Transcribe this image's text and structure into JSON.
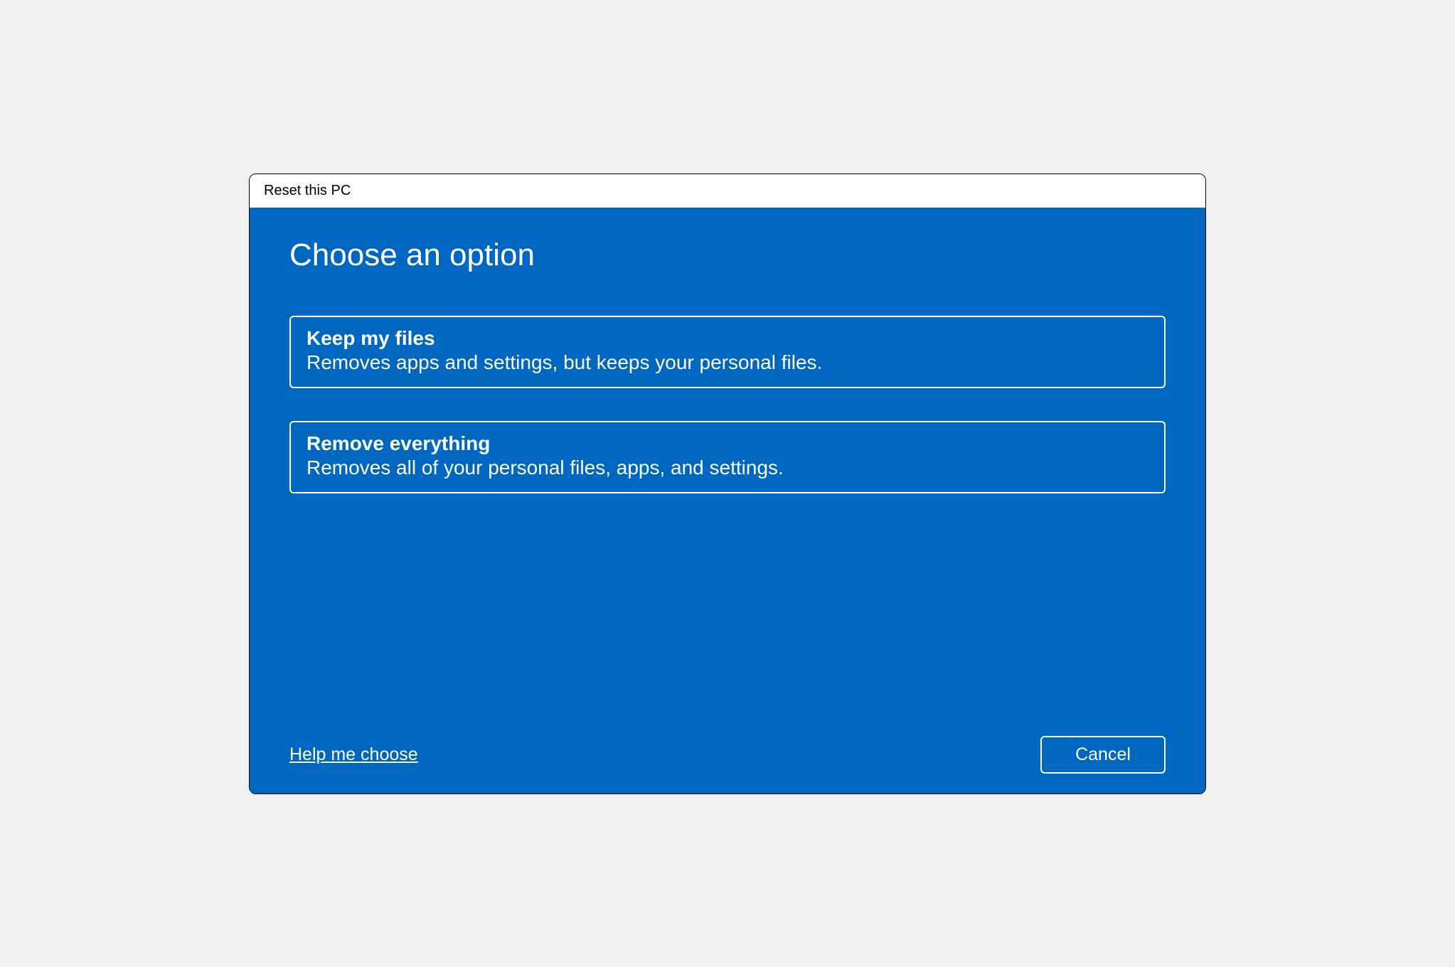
{
  "window": {
    "title": "Reset this PC"
  },
  "page": {
    "heading": "Choose an option"
  },
  "options": [
    {
      "title": "Keep my files",
      "description": "Removes apps and settings, but keeps your personal files."
    },
    {
      "title": "Remove everything",
      "description": "Removes all of your personal files, apps, and settings."
    }
  ],
  "footer": {
    "help_link": "Help me choose",
    "cancel_label": "Cancel"
  },
  "colors": {
    "accent": "#0067c0",
    "text_on_accent": "#ffffff"
  }
}
